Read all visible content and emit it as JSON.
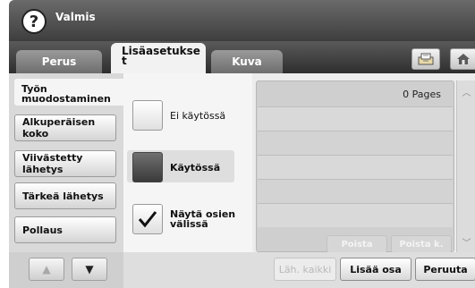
{
  "header": {
    "help_icon": "help-question-icon",
    "help_glyph": "?",
    "status": "Valmis"
  },
  "tabs": [
    {
      "label": "Perus",
      "active": false
    },
    {
      "label": "Lisäasetukse\nt",
      "active": true
    },
    {
      "label": "Kuva",
      "active": false
    }
  ],
  "top_buttons": {
    "print_icon": "printer-tray-icon",
    "home_icon": "home-icon"
  },
  "sidebar": {
    "items": [
      {
        "label": "Työn\nmuodostaminen",
        "selected": true
      },
      {
        "label": "Alkuperäisen koko",
        "selected": false
      },
      {
        "label": "Viivästetty lähetys",
        "selected": false
      },
      {
        "label": "Tärkeä lähetys",
        "selected": false
      },
      {
        "label": "Pollaus",
        "selected": false
      }
    ],
    "up_glyph": "▲",
    "down_glyph": "▼"
  },
  "options": [
    {
      "label": "Ei käytössä",
      "selected": false
    },
    {
      "label": "Käytössä",
      "selected": true
    },
    {
      "label": "Näytä osien\nvälissä",
      "checked": true
    }
  ],
  "pages_panel": {
    "count": "0 Pages",
    "delete_label": "Poista",
    "delete_all_label": "Poista k."
  },
  "scroll": {
    "up_glyph": "︿",
    "down_glyph": "﹀"
  },
  "footer": {
    "prev_all_label": "Läh. kaikki",
    "add_part_label": "Lisää osa",
    "cancel_label": "Peruuta"
  },
  "colors": {
    "header_bg": "#4a4a4a",
    "panel_bg": "#ececec",
    "selected_tab_bg": "#f2f2f2"
  }
}
